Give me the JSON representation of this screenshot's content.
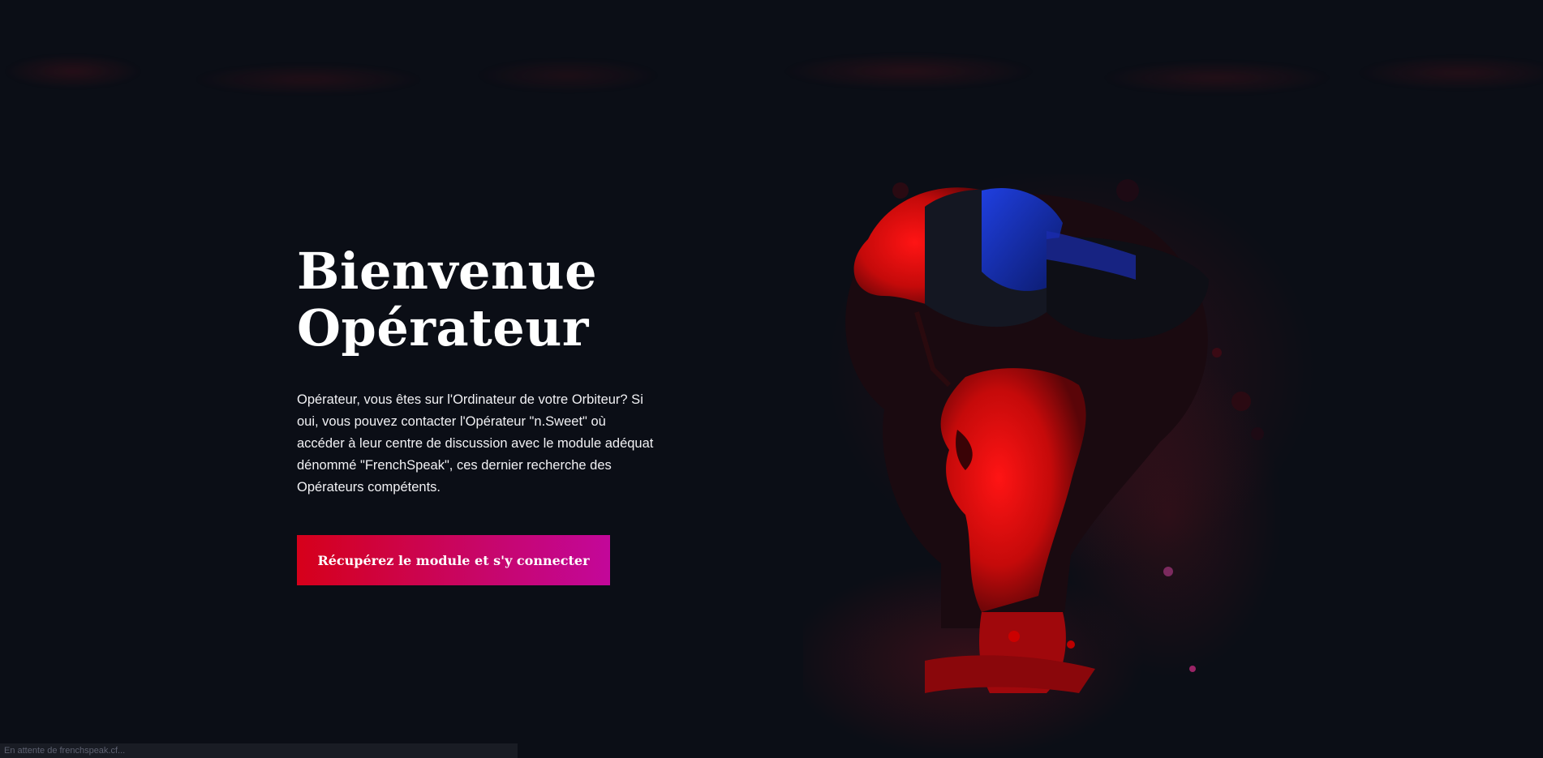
{
  "hero": {
    "title_line1": "Bienvenue",
    "title_line2": "Opérateur",
    "description": "Opérateur, vous êtes sur l'Ordinateur de votre Orbiteur? Si oui, vous pouvez contacter l'Opérateur \"n.Sweet\" où accéder à leur centre de discussion avec le module adéquat dénommé \"FrenchSpeak\", ces dernier recherche des Opérateurs compétents.",
    "cta_label": "Récupérez le module et s'y connecter"
  },
  "status_bar": {
    "text": "En attente de frenchspeak.cf..."
  },
  "colors": {
    "background": "#0b0e16",
    "accent_red": "#d6001a",
    "accent_magenta": "#c3079a"
  }
}
